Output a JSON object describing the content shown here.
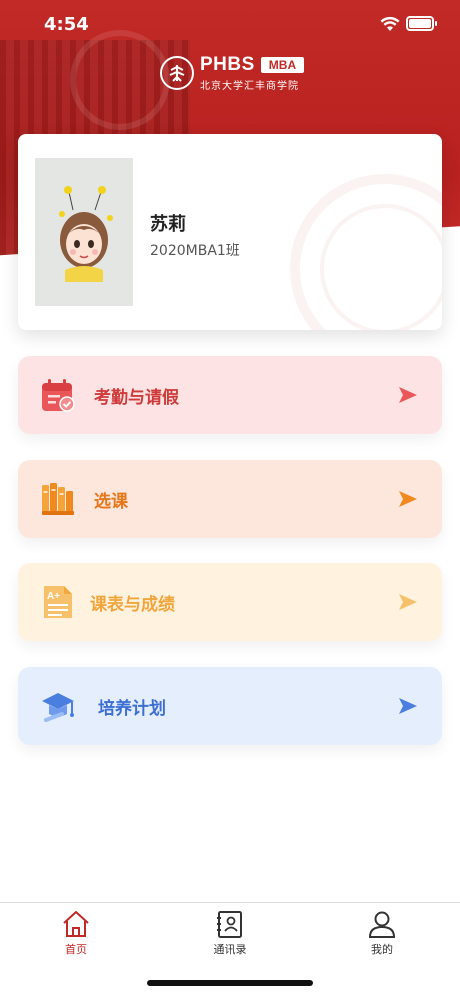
{
  "status_bar": {
    "time": "4:54"
  },
  "logo": {
    "brand": "PHBS",
    "badge": "MBA",
    "subtitle": "北京大学汇丰商学院"
  },
  "profile": {
    "name": "苏莉",
    "class": "2020MBA1班"
  },
  "menu": [
    {
      "label": "考勤与请假",
      "icon": "calendar-check-icon",
      "color": "#cf3a3a"
    },
    {
      "label": "选课",
      "icon": "books-icon",
      "color": "#e8771b"
    },
    {
      "label": "课表与成绩",
      "icon": "grade-document-icon",
      "color": "#f0a53d"
    },
    {
      "label": "培养计划",
      "icon": "graduation-cap-icon",
      "color": "#3b6fd2"
    }
  ],
  "tabbar": [
    {
      "label": "首页",
      "icon": "home-icon",
      "active": true
    },
    {
      "label": "通讯录",
      "icon": "contacts-icon",
      "active": false
    },
    {
      "label": "我的",
      "icon": "user-icon",
      "active": false
    }
  ],
  "colors": {
    "brand_red": "#c22a27"
  }
}
